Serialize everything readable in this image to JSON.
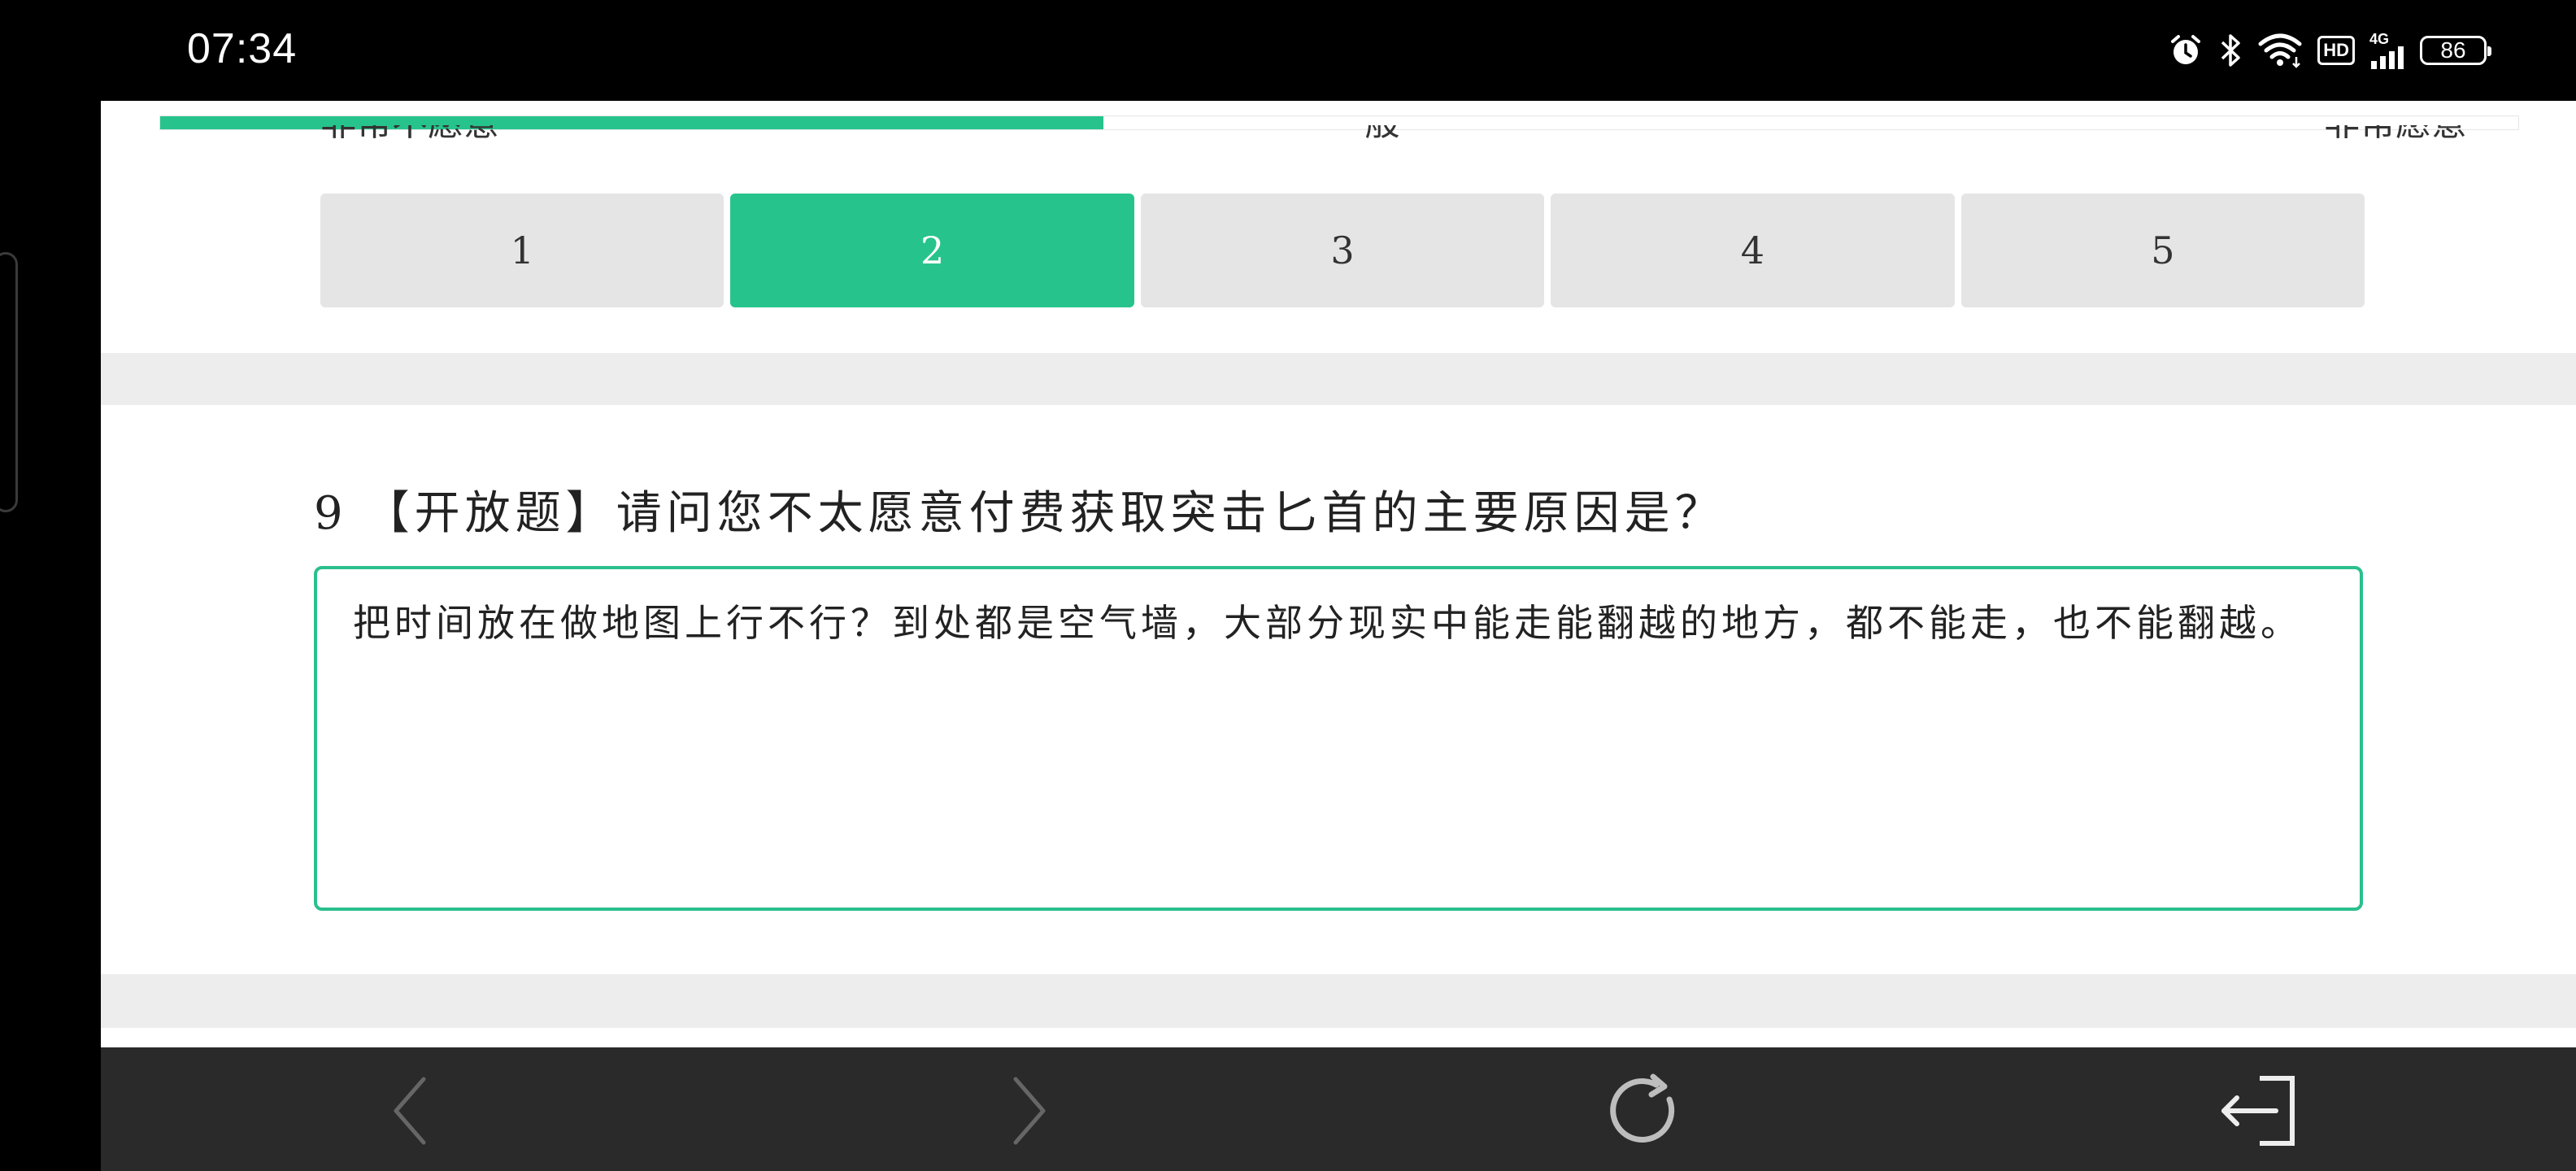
{
  "status_bar": {
    "time": "07:34",
    "network": "4G",
    "hd": "HD",
    "battery": "86",
    "icons": [
      "alarm-icon",
      "bluetooth-icon",
      "wifi-icon",
      "hd-icon",
      "signal-4g-icon",
      "battery-icon"
    ]
  },
  "survey": {
    "progress_percent": 40,
    "scale_labels": {
      "left": "非常不愿意",
      "middle": "一般",
      "right": "非常愿意"
    },
    "rating_options": [
      "1",
      "2",
      "3",
      "4",
      "5"
    ],
    "selected_rating": "2",
    "question": {
      "number": "9",
      "text": "【开放题】请问您不太愿意付费获取突击匕首的主要原因是？"
    },
    "answer": "把时间放在做地图上行不行？到处都是空气墙，大部分现实中能走能翻越的地方，都不能走，也不能翻越。"
  },
  "bottom_nav": {
    "icons": [
      "back-arrow-icon",
      "forward-arrow-icon",
      "reload-icon",
      "exit-icon"
    ]
  },
  "colors": {
    "accent": "#26c48c",
    "option_bg": "#e5e5e5",
    "nav_bg": "#2a2a2a"
  }
}
